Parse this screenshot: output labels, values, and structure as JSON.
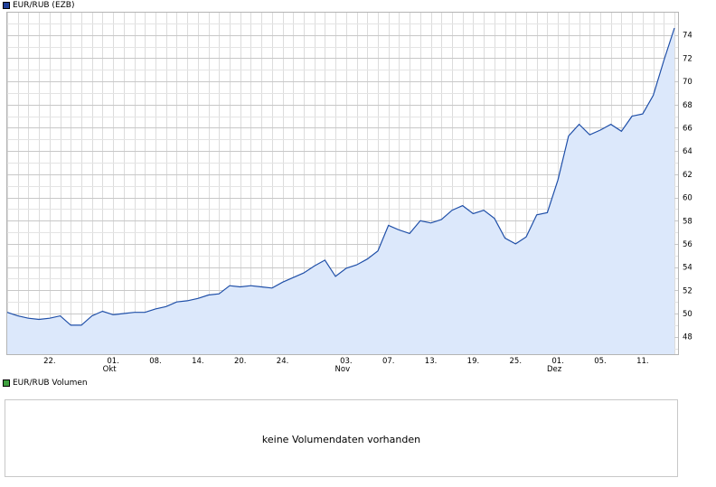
{
  "price_legend": {
    "label": "EUR/RUB (EZB)",
    "color": "#1f3f99"
  },
  "volume_legend": {
    "label": "EUR/RUB Volumen",
    "color": "#3fa03f"
  },
  "volume_panel": {
    "message": "keine Volumendaten vorhanden"
  },
  "chart_data": {
    "type": "area",
    "series": [
      {
        "values": [
          50.1,
          49.8,
          49.6,
          49.5,
          49.6,
          49.8,
          49.0,
          49.0,
          49.8,
          50.2,
          49.9,
          50.0,
          50.1,
          50.1,
          50.4,
          50.6,
          51.0,
          51.1,
          51.3,
          51.6,
          51.7,
          52.4,
          52.3,
          52.4,
          52.3,
          52.2,
          52.7,
          53.1,
          53.5,
          54.1,
          54.6,
          53.2,
          53.9,
          54.2,
          54.7,
          55.4,
          57.6,
          57.2,
          56.9,
          58.0,
          57.8,
          58.1,
          58.9,
          59.3,
          58.6,
          58.9,
          58.2,
          56.5,
          56.0,
          56.6,
          58.5,
          58.7,
          61.5,
          65.3,
          66.3,
          65.4,
          65.8,
          66.3,
          65.7,
          67.0,
          67.2,
          68.8,
          71.8,
          74.6
        ],
        "line_color": "#1f4fa8",
        "fill_color": "#dce8fb"
      }
    ],
    "x_labels": [
      {
        "label": "22.",
        "sub": ""
      },
      {
        "label": "01.",
        "sub": "Okt"
      },
      {
        "label": "08.",
        "sub": ""
      },
      {
        "label": "14.",
        "sub": ""
      },
      {
        "label": "20.",
        "sub": ""
      },
      {
        "label": "24.",
        "sub": ""
      },
      {
        "label": "03.",
        "sub": "Nov"
      },
      {
        "label": "07.",
        "sub": ""
      },
      {
        "label": "13.",
        "sub": ""
      },
      {
        "label": "19.",
        "sub": ""
      },
      {
        "label": "25.",
        "sub": ""
      },
      {
        "label": "01.",
        "sub": "Dez"
      },
      {
        "label": "05.",
        "sub": ""
      },
      {
        "label": "11.",
        "sub": ""
      }
    ],
    "y_ticks": [
      48,
      50,
      52,
      54,
      56,
      58,
      60,
      62,
      64,
      66,
      68,
      70,
      72,
      74
    ],
    "ylim": [
      46.5,
      76.0
    ],
    "grid": true,
    "y_axis_side": "right"
  }
}
